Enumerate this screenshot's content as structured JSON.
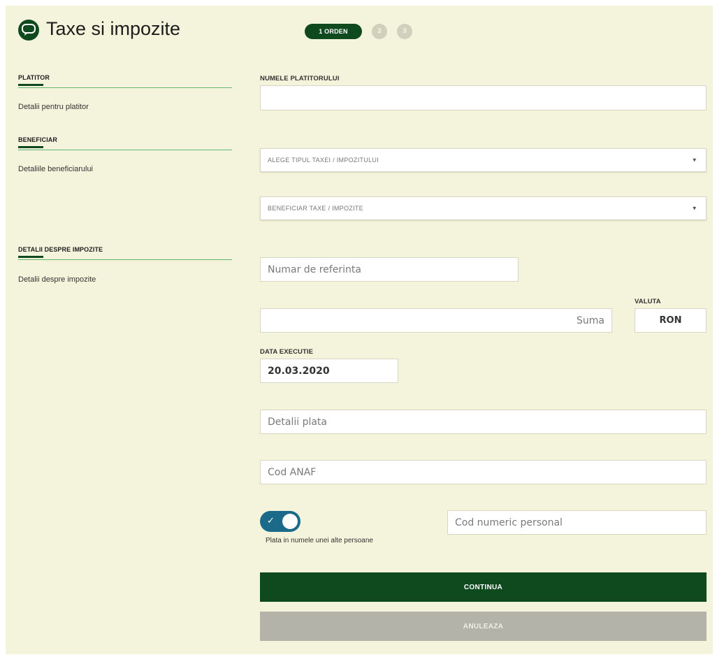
{
  "header": {
    "title": "Taxe si impozite",
    "icon": "chat-bubble-icon",
    "steps": {
      "active": "1 ORDEN",
      "step2": "2",
      "step3": "3"
    }
  },
  "nav": {
    "sections": [
      {
        "title": "PLATITOR",
        "subtitle": "Detalii pentru platitor"
      },
      {
        "title": "BENEFICIAR",
        "subtitle": "Detaliile beneficiarului"
      },
      {
        "title": "DETALII DESPRE IMPOZITE",
        "subtitle": "Detalii despre impozite"
      }
    ]
  },
  "form": {
    "payer_name_label": "NUMELE PLATITORULUI",
    "payer_name_value": "",
    "tax_type_select": "ALEGE TIPUL TAXEI / IMPOZITULUI",
    "beneficiary_select": "BENEFICIAR TAXE / IMPOZITE",
    "reference_placeholder": "Numar de referinta",
    "amount_placeholder": "Suma",
    "currency_label": "VALUTA",
    "currency_value": "RON",
    "date_label": "DATA EXECUTIE",
    "date_value": "20.03.2020",
    "payment_details_placeholder": "Detalii plata",
    "anaf_code_placeholder": "Cod ANAF",
    "toggle_label": "Plata in numele unei alte persoane",
    "toggle_on": true,
    "cnp_placeholder": "Cod numeric personal"
  },
  "buttons": {
    "continue": "CONTINUA",
    "cancel": "ANULEAZA"
  },
  "colors": {
    "background": "#f4f4dc",
    "primary": "#0f4a1f",
    "accent_line": "#5fb56f",
    "toggle": "#1b6a8a",
    "disabled_button": "#b3b3aa"
  }
}
